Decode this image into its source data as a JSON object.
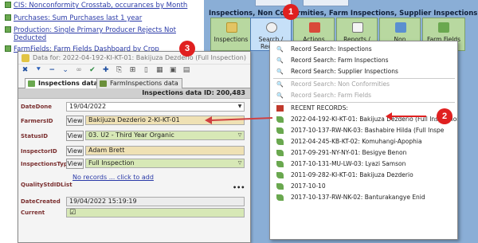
{
  "background_links": [
    "CIS: Nonconformity Crosstab, occurances by Month",
    "Purchases: Sum Purchases last 1 year",
    "Production: Single Primary Producer Rejects Not",
    "Deducted",
    "FarmFields: Farm Fields Dashboard by Crop"
  ],
  "section_title": "Inspections, Non Conformities, Farm Inspections, Supplier Inspections",
  "toolbar_buttons": [
    {
      "label": "Inspections"
    },
    {
      "label": "Search /\nRecent"
    },
    {
      "label": "Actions"
    },
    {
      "label": "Reports /\nDashboards"
    },
    {
      "label": "Non\nConformities"
    },
    {
      "label": "Farm Fields"
    }
  ],
  "dialog": {
    "title": "Data for: 2022-04-192-KI-KT-01: Bakijuza Dezderio (Full Inspection)",
    "tabs": [
      "Inspections data",
      "FarmInspections data"
    ],
    "form_header": "Inspections data ID: 200,483",
    "view_label": "View",
    "fields": {
      "date_done": {
        "label": "DateDone",
        "value": "19/04/2022"
      },
      "farmers_id": {
        "label": "FarmersID",
        "value": "Bakijuza Dezderio 2-KI-KT-01"
      },
      "status_id": {
        "label": "StatusID",
        "value": "03. U2 - Third Year Organic"
      },
      "inspector_id": {
        "label": "InspectorID",
        "value": "Adam Brett"
      },
      "inspections_type_id": {
        "label": "InspectionsTypeID",
        "value": "Full Inspection"
      },
      "quality_std_id_list": {
        "label": "QualityStdIDList",
        "value": "No records ... click to add"
      },
      "date_created": {
        "label": "DateCreated",
        "value": "19/04/2022 15:19:19"
      },
      "current": {
        "label": "Current",
        "value": "☑"
      }
    },
    "dots": "•••"
  },
  "popup_menu": {
    "search_items": [
      {
        "label": "Record Search: Inspections",
        "enabled": true
      },
      {
        "label": "Record Search: Farm Inspections",
        "enabled": true
      },
      {
        "label": "Record Search: Supplier Inspections",
        "enabled": true
      },
      {
        "label": "Record Search: Non Conformities",
        "enabled": false
      },
      {
        "label": "Record Search: Farm Fields",
        "enabled": false
      }
    ],
    "recent_header": "RECENT RECORDS:",
    "recent_items": [
      "2022-04-192-KI-KT-01: Bakijuza Dezderio (Full Inspection)",
      "2017-10-137-RW-NK-03: Bashabire Hilda (Full Inspe",
      "2012-04-245-KB-KT-02: Komuhangi-Apophia",
      "2017-09-291-NY-NY-01: Besigye Benon",
      "2017-10-131-MU-LW-03: Lyazi Samson",
      "2011-09-282-KI-KT-01: Bakijuza Dezderio",
      "2017-10-10",
      "2017-10-137-RW-NK-02: Banturakangye Enid"
    ]
  },
  "callouts": [
    "1",
    "2",
    "3"
  ],
  "colors": {
    "callout": "#e02020",
    "panel_blue": "#8aaed6",
    "button_green": "#b8d8a0",
    "field_beige": "#efe1b4",
    "field_green": "#d7e8b6"
  }
}
